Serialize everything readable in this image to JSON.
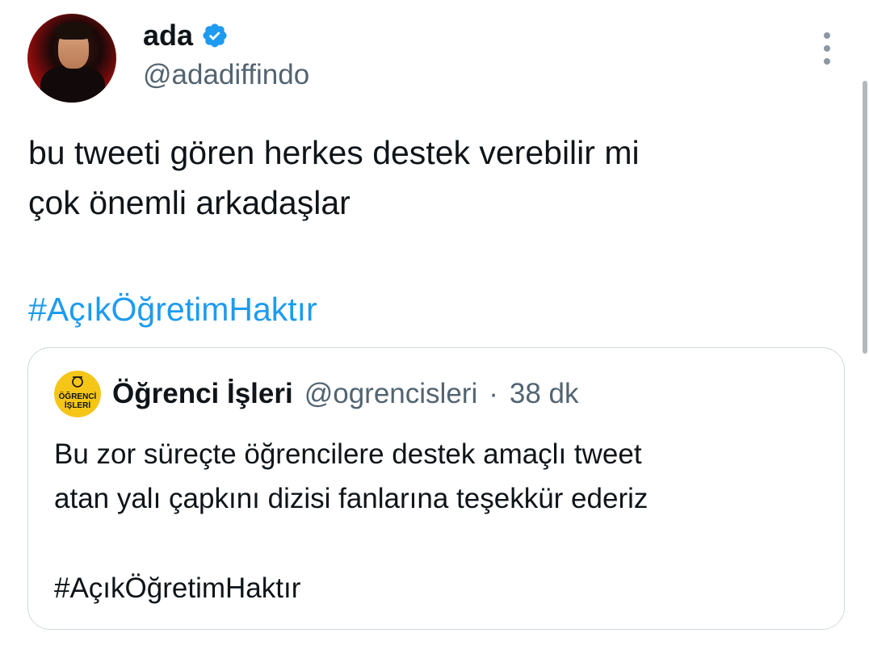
{
  "author": {
    "name": "ada",
    "handle": "@adadiffindo",
    "verified": true
  },
  "tweet": {
    "line1": "bu tweeti gören herkes destek verebilir mi",
    "line2": "çok önemli arkadaşlar",
    "hashtag": "#AçıkÖğretimHaktır"
  },
  "quoted_tweet": {
    "name": "Öğrenci İşleri",
    "handle": "@ogrencisleri",
    "separator": "·",
    "time": "38 dk",
    "avatar_text_top": "ÖĞRENCİ",
    "avatar_text_bottom": "İŞLERİ",
    "line1": "Bu zor süreçte öğrencilere destek amaçlı tweet",
    "line2": "atan yalı çapkını dizisi fanlarına teşekkür ederiz",
    "hashtag": "#AçıkÖğretimHaktır"
  },
  "icons": {
    "verified": "verified-badge-icon",
    "more": "more-vertical-icon"
  },
  "colors": {
    "accent": "#1d9bf0",
    "secondary_text": "#536471",
    "border": "#cfd9de",
    "quote_avatar_yellow": "#f5c518"
  }
}
